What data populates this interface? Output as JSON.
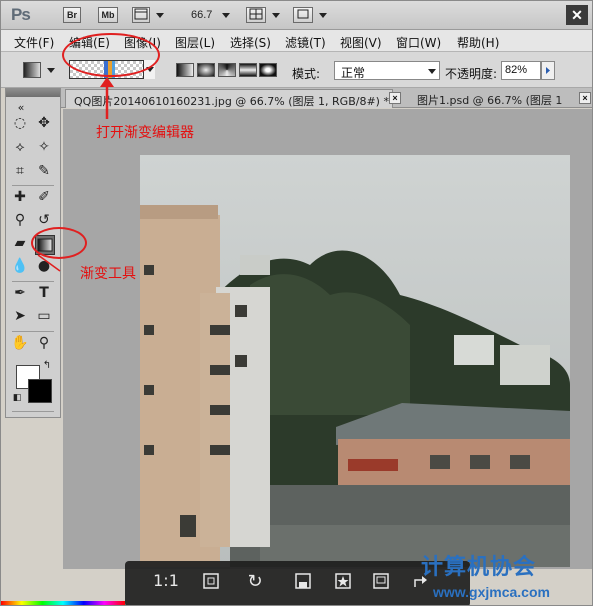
{
  "app": {
    "logo": "Ps",
    "bridge_label": "Br",
    "minibridge_label": "Mb",
    "zoom": "66.7",
    "close_label": "✕"
  },
  "menu": {
    "items": [
      "文件(F)",
      "编辑(E)",
      "图像(I)",
      "图层(L)",
      "选择(S)",
      "滤镜(T)",
      "视图(V)",
      "窗口(W)",
      "帮助(H)"
    ]
  },
  "options": {
    "mode_label": "模式:",
    "mode_value": "正常",
    "opacity_label": "不透明度:",
    "opacity_value": "82%"
  },
  "tabs": [
    {
      "label": "QQ图片20140610160231.jpg @ 66.7% (图层 1, RGB/8#) *",
      "active": true
    },
    {
      "label": "图片1.psd @ 66.7% (图层 1",
      "active": false
    }
  ],
  "annotations": {
    "open_editor": "打开渐变编辑器",
    "gradient_tool": "渐变工具"
  },
  "viewer": {
    "actual_size": "1:1"
  },
  "watermark": {
    "title": "计算机协会",
    "url": "www.gxjmca.com"
  },
  "colors": {
    "annotation": "#e41010",
    "watermark": "#2a70c0",
    "workspace": "#a6a6a6"
  }
}
